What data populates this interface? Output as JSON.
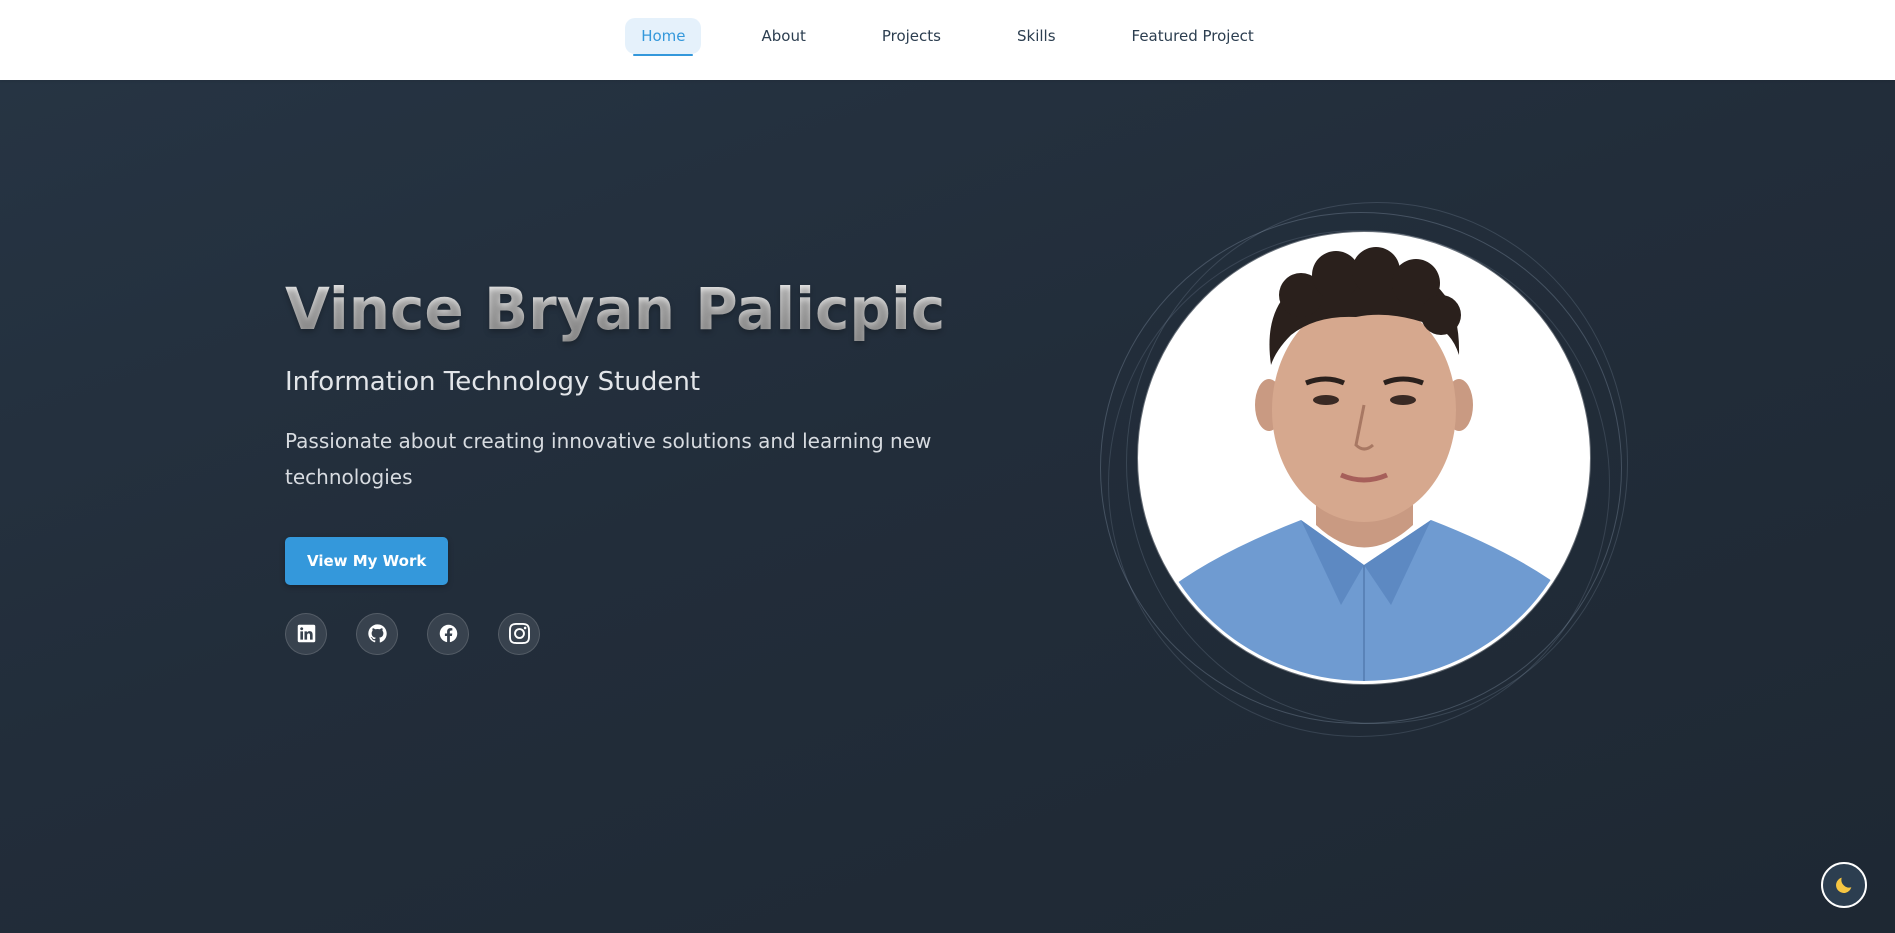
{
  "nav": {
    "items": [
      {
        "label": "Home",
        "active": true
      },
      {
        "label": "About",
        "active": false
      },
      {
        "label": "Projects",
        "active": false
      },
      {
        "label": "Skills",
        "active": false
      },
      {
        "label": "Featured Project",
        "active": false
      }
    ]
  },
  "hero": {
    "name": "Vince Bryan Palicpic",
    "subtitle": "Information Technology Student",
    "description": "Passionate about creating innovative solutions and learning new technologies",
    "cta_label": "View My Work",
    "socials": [
      {
        "icon": "linkedin-icon"
      },
      {
        "icon": "github-icon"
      },
      {
        "icon": "facebook-icon"
      },
      {
        "icon": "instagram-icon"
      }
    ],
    "profile_image": "profile-photo"
  },
  "theme_toggle": {
    "icon": "moon-icon"
  },
  "colors": {
    "accent": "#3498db",
    "hero_bg": "#232f3c",
    "nav_bg": "#ffffff",
    "nav_text": "#2c3e50",
    "active_bg": "#e5f1fb"
  }
}
